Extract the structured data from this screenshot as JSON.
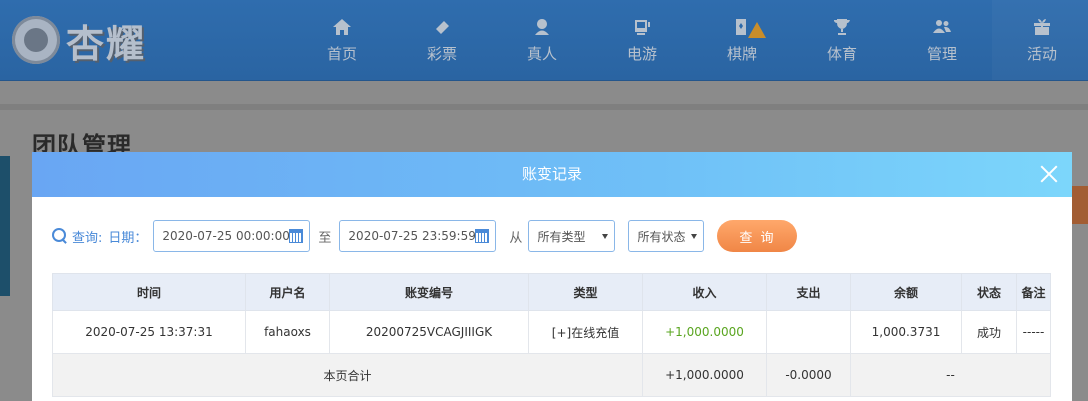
{
  "site": {
    "logo_text": "杏耀"
  },
  "nav": [
    {
      "label": "首页",
      "icon": "home-icon"
    },
    {
      "label": "彩票",
      "icon": "lottery-icon"
    },
    {
      "label": "真人",
      "icon": "live-dealer-icon"
    },
    {
      "label": "电游",
      "icon": "slot-machine-icon"
    },
    {
      "label": "棋牌",
      "icon": "card-game-icon"
    },
    {
      "label": "体育",
      "icon": "trophy-icon"
    },
    {
      "label": "管理",
      "icon": "users-icon"
    },
    {
      "label": "活动",
      "icon": "gift-icon"
    }
  ],
  "page": {
    "title": "团队管理"
  },
  "modal": {
    "title": "账变记录",
    "filter": {
      "query_label": "查询:",
      "date_label": "日期：",
      "start_date": "2020-07-25 00:00:00",
      "to_label": "至",
      "end_date": "2020-07-25 23:59:59",
      "from_label": "从",
      "type_select": "所有类型",
      "status_select": "所有状态",
      "search_button": "查 询"
    },
    "table": {
      "headers": [
        "时间",
        "用户名",
        "账变编号",
        "类型",
        "收入",
        "支出",
        "余额",
        "状态",
        "备注"
      ],
      "rows": [
        [
          "2020-07-25 13:37:31",
          "fahaoxs",
          "20200725VCAGJIIIGK",
          "[+]在线充值",
          "+1,000.0000",
          "",
          "1,000.3731",
          "成功",
          "-----"
        ]
      ],
      "total": {
        "label": "本页合计",
        "income": "+1,000.0000",
        "expense": "-0.0000",
        "balance": "--"
      }
    }
  },
  "colors": {
    "accent": "#4a8ad8",
    "income_green": "#5aa520",
    "query_button": "#f08646"
  }
}
